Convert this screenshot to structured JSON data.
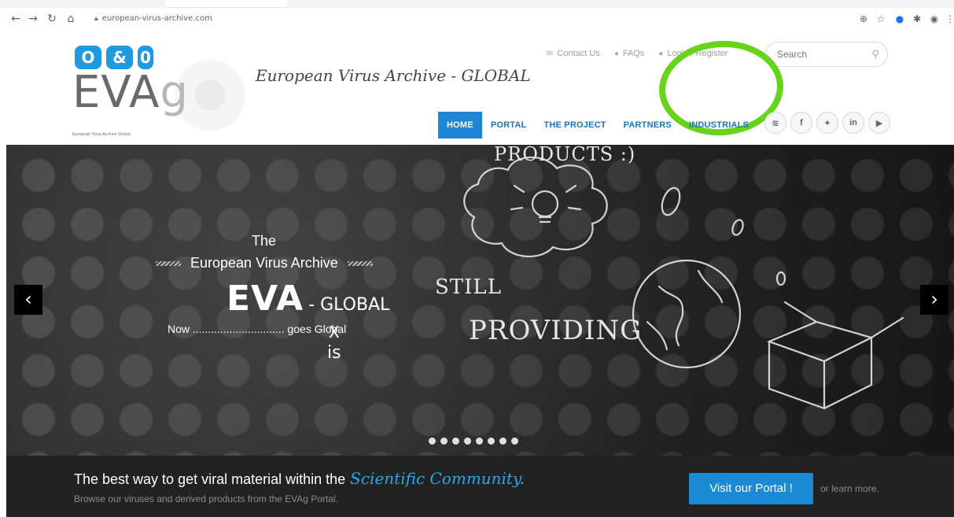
{
  "browser": {
    "url": "european-virus-archive.com"
  },
  "logo": {
    "tiles": [
      "O",
      "&",
      "0"
    ],
    "word": "EVA",
    "word_g": "g",
    "subtitle": "European Virus Archive Global"
  },
  "site_title": "European Virus Archive - GLOBAL",
  "top_links": {
    "contact": "Contact Us",
    "faqs": "FAQs",
    "login": "Login / Register"
  },
  "search": {
    "placeholder": "Search"
  },
  "nav": [
    "HOME",
    "PORTAL",
    "THE PROJECT",
    "PARTNERS",
    "INDUSTRIALS"
  ],
  "social": [
    "rss",
    "f",
    "twitter",
    "in",
    "yt"
  ],
  "hero": {
    "the": "The",
    "eva_full": "European Virus Archive",
    "eva": "EVA",
    "global": "- GLOBAL",
    "now": "Now .............................. goes Global",
    "x": "X",
    "is": "is",
    "chalk_products": "PRODUCTS :)",
    "chalk_still": "STILL",
    "chalk_providing": "PROVIDING",
    "slides": 8
  },
  "banner": {
    "headline": "The best way to get viral material within the",
    "headline_script": "Scientific Community.",
    "sub": "Browse our viruses and derived products from the EVAg Portal.",
    "button": "Visit our Portal !",
    "learn": "or learn more."
  }
}
